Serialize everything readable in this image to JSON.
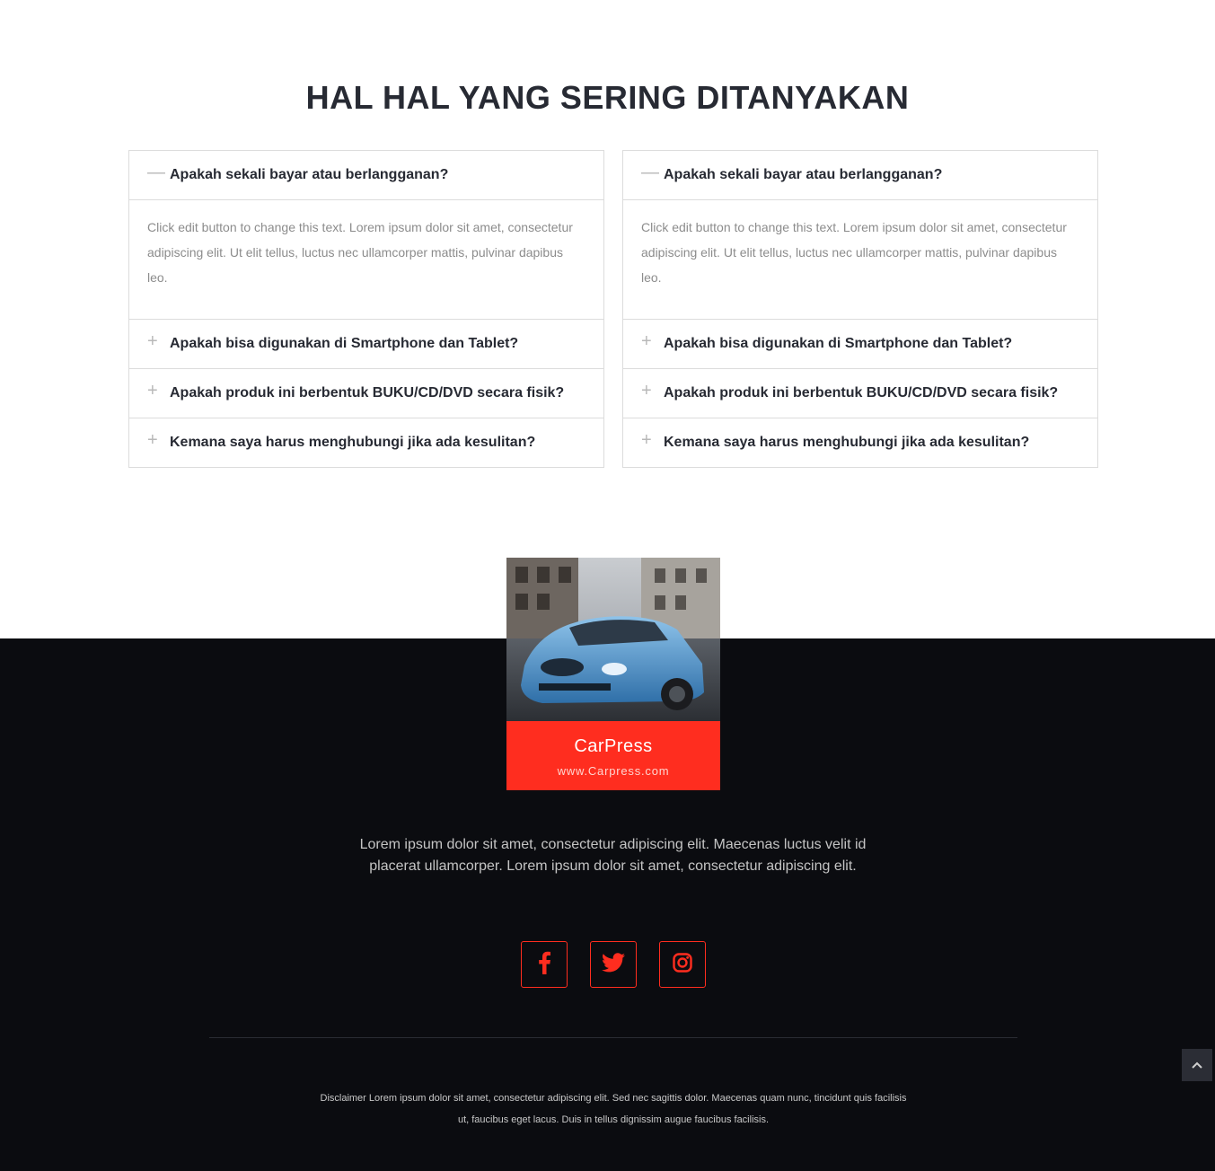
{
  "faq": {
    "title": "HAL HAL YANG SERING DITANYAKAN",
    "left": {
      "items": [
        {
          "question": "Apakah sekali bayar atau berlangganan?",
          "icon": "minus-icon",
          "answer": "Click edit button to change this text. Lorem ipsum dolor sit amet, consectetur adipiscing elit. Ut elit tellus, luctus nec ullamcorper mattis, pulvinar dapibus leo."
        },
        {
          "question": "Apakah bisa digunakan di Smartphone dan Tablet?",
          "icon": "plus-icon"
        },
        {
          "question": "Apakah produk ini berbentuk BUKU/CD/DVD secara fisik?",
          "icon": "plus-icon"
        },
        {
          "question": "Kemana saya harus menghubungi jika ada kesulitan?",
          "icon": "plus-icon"
        }
      ]
    },
    "right": {
      "items": [
        {
          "question": "Apakah sekali bayar atau berlangganan?",
          "icon": "minus-icon",
          "answer": "Click edit button to change this text. Lorem ipsum dolor sit amet, consectetur adipiscing elit. Ut elit tellus, luctus nec ullamcorper mattis, pulvinar dapibus leo."
        },
        {
          "question": "Apakah bisa digunakan di Smartphone dan Tablet?",
          "icon": "plus-icon"
        },
        {
          "question": "Apakah produk ini berbentuk BUKU/CD/DVD secara fisik?",
          "icon": "plus-icon"
        },
        {
          "question": "Kemana saya harus menghubungi jika ada kesulitan?",
          "icon": "plus-icon"
        }
      ]
    }
  },
  "footer": {
    "logo": {
      "name": "CarPress",
      "url": "www.Carpress.com"
    },
    "description": "Lorem ipsum dolor sit amet, consectetur adipiscing elit. Maecenas luctus velit id placerat ullamcorper. Lorem ipsum dolor sit amet, consectetur adipiscing elit.",
    "social": [
      "facebook-icon",
      "twitter-icon",
      "instagram-icon"
    ],
    "disclaimer": "Disclaimer Lorem ipsum dolor sit amet, consectetur adipiscing elit. Sed nec sagittis dolor. Maecenas quam nunc, tincidunt quis facilisis ut, faucibus eget lacus. Duis in tellus dignissim augue faucibus facilisis."
  },
  "colors": {
    "accent": "#ff2d1f",
    "footer_bg": "#0b0c10",
    "heading": "#272a33"
  }
}
